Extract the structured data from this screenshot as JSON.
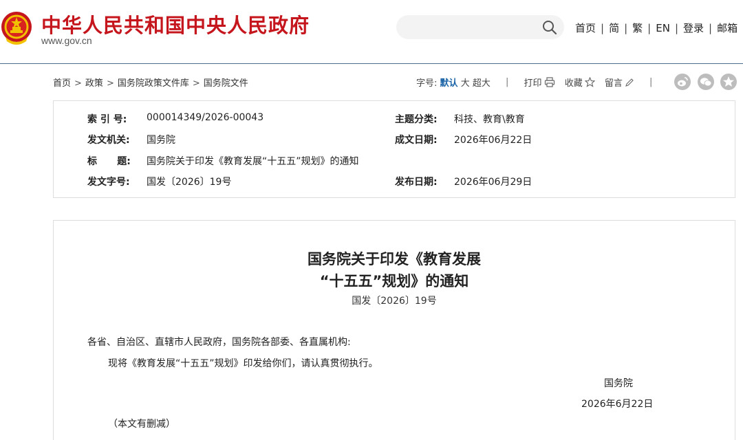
{
  "header": {
    "site_title": "中华人民共和国中央人民政府",
    "site_url": "www.gov.cn",
    "search_placeholder": "",
    "nav": [
      "首页",
      "简",
      "繁",
      "EN",
      "登录",
      "邮箱"
    ],
    "nav_separator": "|"
  },
  "breadcrumb": {
    "items": [
      "首页",
      "政策",
      "国务院政策文件库",
      "国务院文件"
    ],
    "separator": ">"
  },
  "toolbar": {
    "font_size_label": "字号:",
    "font_default": "默认",
    "font_large": "大",
    "font_xlarge": "超大",
    "separator": "|",
    "print": "打印",
    "favorite": "收藏",
    "comment": "留言"
  },
  "metadata": {
    "index_label": "索 引 号:",
    "index_value": "000014349/2026-00043",
    "category_label": "主题分类:",
    "category_value": "科技、教育\\教育",
    "issuer_label": "发文机关:",
    "issuer_value": "国务院",
    "written_date_label": "成文日期:",
    "written_date_value": "2026年06月22日",
    "title_label": "标      题:",
    "title_value": "国务院关于印发《教育发展“十五五”规划》的通知",
    "doc_number_label": "发文字号:",
    "doc_number_value": "国发〔2026〕19号",
    "publish_date_label": "发布日期:",
    "publish_date_value": "2026年06月29日"
  },
  "article": {
    "title_line1": "国务院关于印发《教育发展",
    "title_line2": "“十五五”规划》的通知",
    "doc_number": "国发〔2026〕19号",
    "salutation": "各省、自治区、直辖市人民政府，国务院各部委、各直属机构:",
    "body": "现将《教育发展“十五五”规划》印发给你们，请认真贯彻执行。",
    "signer": "国务院",
    "date": "2026年6月22日",
    "note": "（本文有删减）"
  },
  "colors": {
    "brand_red": "#c5161d",
    "emblem_gold": "#f2c200",
    "link_blue": "#1a63a6",
    "header_rule": "#4a6f8f"
  }
}
